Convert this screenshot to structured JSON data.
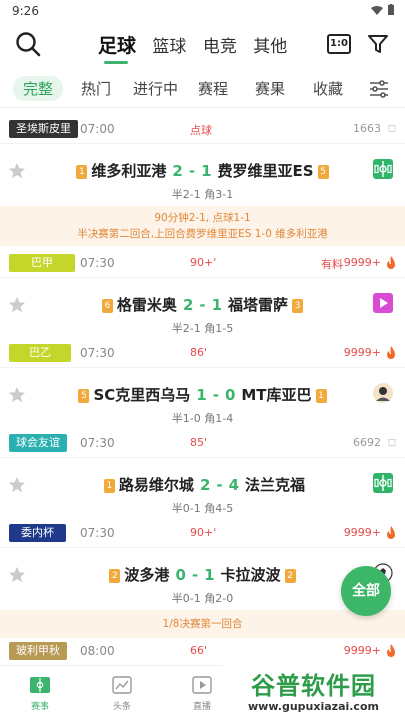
{
  "status_bar": {
    "time": "9:26"
  },
  "sports_tabs": [
    "足球",
    "篮球",
    "电竞",
    "其他"
  ],
  "score_toggle_label": "1:0",
  "sub_tabs": [
    "完整",
    "热门",
    "进行中",
    "赛程",
    "赛果",
    "收藏"
  ],
  "rows": [
    {
      "league": "圣埃斯皮里",
      "league_color": "#333333",
      "time": "07:00",
      "status": "点球",
      "count": "1663",
      "hot": false
    },
    {
      "league": "巴甲",
      "league_color": "#c5d62b",
      "time": "07:30",
      "status": "90+'",
      "extra": "有料",
      "count": "9999+",
      "hot": true
    },
    {
      "league": "巴乙",
      "league_color": "#c5d62b",
      "time": "07:30",
      "status": "86'",
      "count": "9999+",
      "hot": true
    },
    {
      "league": "球会友谊",
      "league_color": "#2ab0b0",
      "time": "07:30",
      "status": "85'",
      "count": "6692",
      "hot": false
    },
    {
      "league": "委内杯",
      "league_color": "#1f3a8a",
      "time": "07:30",
      "status": "90+'",
      "count": "9999+",
      "hot": true
    },
    {
      "league": "玻利甲秋",
      "league_color": "#b89a55",
      "time": "08:00",
      "status": "66'",
      "count": "9999+",
      "hot": true
    }
  ],
  "matches": [
    {
      "home": "维多利亚港",
      "home_badge": "1",
      "home_score": "2",
      "away_score": "1",
      "away": "费罗维里亚ES",
      "away_badge": "5",
      "half": "半2-1 角3-1",
      "media": "field",
      "notice": [
        "90分钟2-1, 点球1-1",
        "半决赛第二回合,上回合费罗维里亚ES 1-0 维多利亚港"
      ]
    },
    {
      "home": "格雷米奥",
      "home_badge": "6",
      "home_score": "2",
      "away_score": "1",
      "away": "福塔雷萨",
      "away_badge": "3",
      "half": "半2-1 角1-5",
      "media": "video"
    },
    {
      "home": "SC克里西乌马",
      "home_badge": "5",
      "home_score": "1",
      "away_score": "0",
      "away": "MT库亚巴",
      "away_badge": "1",
      "half": "半1-0 角1-4",
      "media": "avatar"
    },
    {
      "home": "路易维尔城",
      "home_badge": "1",
      "home_score": "2",
      "away_score": "4",
      "away": "法兰克福",
      "away_badge": "",
      "half": "半0-1 角4-5",
      "media": "field"
    },
    {
      "home": "波多港",
      "home_badge": "2",
      "home_score": "0",
      "away_score": "1",
      "away": "卡拉波波",
      "away_badge": "2",
      "half": "半0-1 角2-0",
      "media": "ball",
      "notice": [
        "1/8决赛第一回合"
      ]
    }
  ],
  "quick_button": "全部",
  "bottom_nav": [
    "赛事",
    "头条",
    "直播"
  ],
  "watermark": {
    "title": "谷普软件园",
    "url": "www.gupuxiazai.com"
  },
  "colors": {
    "accent": "#3db46d",
    "live_red": "#e84a4a",
    "notice_bg": "#fdf3e8"
  }
}
